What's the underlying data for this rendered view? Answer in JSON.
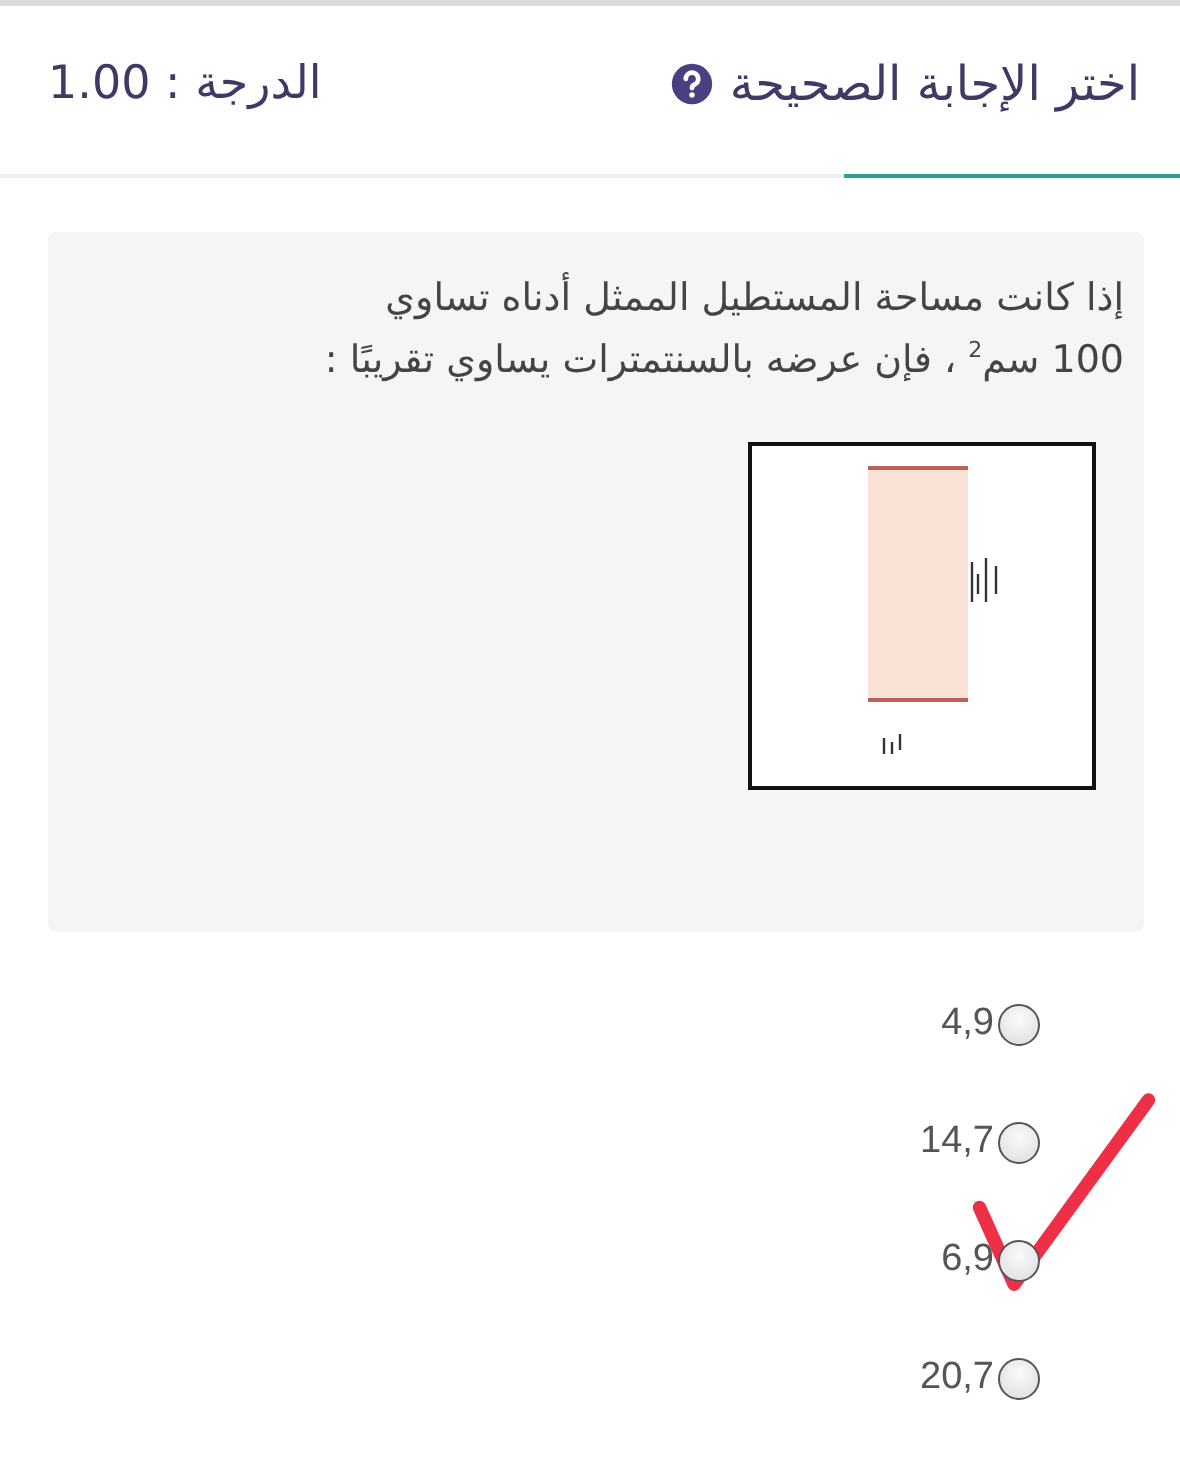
{
  "header": {
    "title": "اختر الإجابة الصحيحة",
    "grade": "الدرجة : 1.00"
  },
  "question": {
    "text": "إذا كانت مساحة المستطيل الممثل أدناه تساوي  100 سم$^{2}$ ، فإن عرضه بالسنتمترات يساوي تقريبًا  :"
  },
  "options": [
    {
      "label": "4,9",
      "selected": false
    },
    {
      "label": "14,7",
      "selected": false
    },
    {
      "label": "6,9",
      "selected": false
    },
    {
      "label": "20,7",
      "selected": false
    }
  ]
}
